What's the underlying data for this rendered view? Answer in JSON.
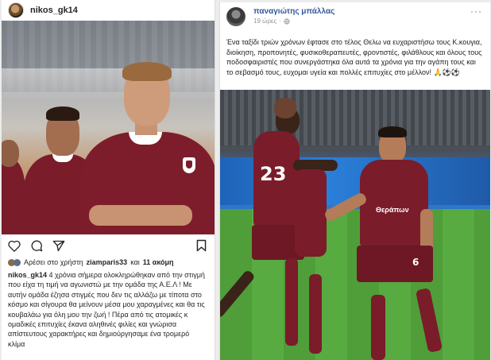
{
  "instagram": {
    "username": "nikos_gk14",
    "liked_by_prefix": "Αρέσει στο χρήστη",
    "liked_by_user": "ziamparis33",
    "liked_by_connector": "και",
    "liked_by_others": "11 ακόμη",
    "caption_user": "nikos_gk14",
    "caption_text": "4 χρόνια σήμερα ολοκληρώθηκαν από την στιγμή που είχα τη τιμή να αγωνιστώ με την ομάδα της Α.Ε.Λ ! Με αυτήν ομάδα έζησα στιγμές που δεν τις αλλάζω με τίποτα στο κόσμο και σίγουρα θα μείνουν μέσα μου χαραγμένες και θα τις κουβαλάω για όλη μου την ζωή ! Πέρα από τις ατομικές κ ομαδικές επιτυχίες έκανα αληθινές φιλίες και γνώρισα απίστευτους χαρακτήρες και δημιούργησαμε ένα τρομερό κλίμα"
  },
  "facebook": {
    "author": "παναγιώτης μπάλλας",
    "time": "19 ώρες",
    "more": "···",
    "post_text": "Ένα ταξίδι τριών χρόνων έφτασε στο τέλος Θελω να ευχαριστήσω τους Κ.κουγια, διοίκηση, προπονητές, φυσικοθεραπευτές, φροντιστές, φιλάθλους και όλους τους ποδοσφαιριστές που συνεργάστηκα όλα αυτά τα χρόνια για την αγάπη τους και το σεβασμό τους, ευχομαι υγεία και πολλές επιτυχίες στο μέλλον! 🙏⚽⚽",
    "photo": {
      "jersey_number_left": "23",
      "jersey_number_right": "6",
      "sponsor": "Θεράπων"
    }
  },
  "colors": {
    "jersey": "#7a1c2a",
    "link": "#365899",
    "ig_text": "#262626"
  }
}
